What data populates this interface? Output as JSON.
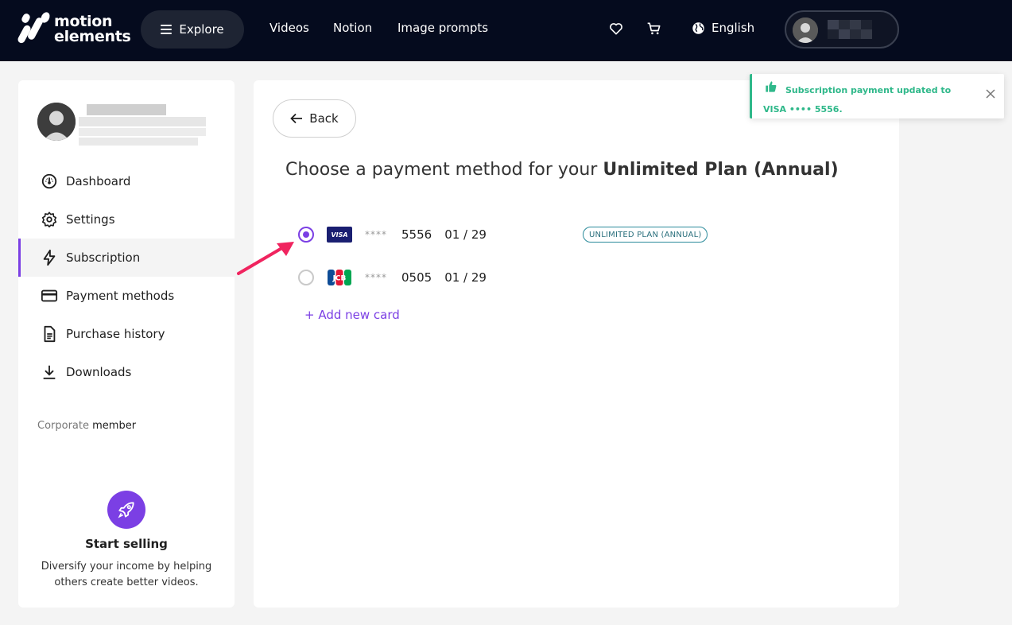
{
  "brand": {
    "line1": "motion",
    "line2": "elements"
  },
  "nav": {
    "explore": "Explore",
    "links": [
      "Videos",
      "Notion",
      "Image prompts"
    ],
    "language": "English"
  },
  "sidebar": {
    "items": [
      {
        "label": "Dashboard",
        "icon": "gauge-icon"
      },
      {
        "label": "Settings",
        "icon": "gear-icon"
      },
      {
        "label": "Subscription",
        "icon": "lightning-icon",
        "active": true
      },
      {
        "label": "Payment methods",
        "icon": "credit-card-icon"
      },
      {
        "label": "Purchase history",
        "icon": "receipt-icon"
      },
      {
        "label": "Downloads",
        "icon": "download-icon"
      }
    ],
    "membership_prefix": "Corporate",
    "membership_suffix": "member",
    "sell_title": "Start selling",
    "sell_desc": "Diversify your income by helping others create better videos."
  },
  "main": {
    "back_label": "Back",
    "heading_prefix": "Choose a payment method for your",
    "heading_plan": "Unlimited Plan (Annual)",
    "cards": [
      {
        "brand": "VISA",
        "mask": "****",
        "last4": "5556",
        "expiry": "01 / 29",
        "selected": true,
        "badge": "UNLIMITED PLAN (ANNUAL)"
      },
      {
        "brand": "JCB",
        "mask": "****",
        "last4": "0505",
        "expiry": "01 / 29",
        "selected": false
      }
    ],
    "add_card": "+ Add new card"
  },
  "toast": {
    "message": "Subscription payment updated to VISA •••• 5556.",
    "color": "#2fb88a"
  },
  "colors": {
    "accent": "#7b3fe4",
    "topbar": "#050b1e"
  }
}
